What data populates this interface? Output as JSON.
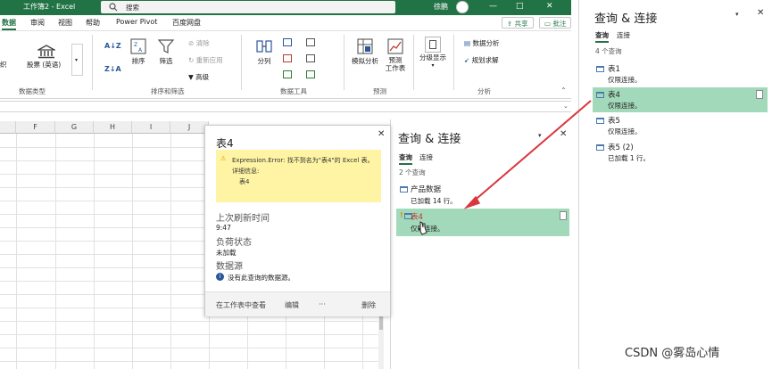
{
  "title_bar": {
    "title": "工作簿2 - Excel",
    "search_placeholder": "搜索",
    "user": "徐鹏",
    "win_min": "—",
    "win_max": "□",
    "win_close": "✕"
  },
  "menu": {
    "items": [
      "数据",
      "审阅",
      "视图",
      "帮助",
      "Power Pivot",
      "百度网盘"
    ],
    "share": "共享",
    "comment": "批注"
  },
  "ribbon": {
    "datatype": {
      "frag": "织",
      "stocks": "股票 (英语)",
      "group": "数据类型"
    },
    "sort_filter": {
      "sort": "排序",
      "filter": "筛选",
      "clear": "清除",
      "reapply": "重新应用",
      "advanced": "高级",
      "group": "排序和筛选"
    },
    "data_tools": {
      "split": "分列",
      "group": "数据工具"
    },
    "forecast": {
      "whatif": "模拟分析",
      "forecast_sheet": "预测\n工作表",
      "group": "预测"
    },
    "outline": {
      "label": "分级显示"
    },
    "analysis": {
      "data_analysis": "数据分析",
      "solver": "规划求解",
      "group": "分析"
    }
  },
  "grid": {
    "columns": [
      "F",
      "G",
      "H",
      "I",
      "J"
    ]
  },
  "pane_inner": {
    "title": "查询 & 连接",
    "tab_queries": "查询",
    "tab_connections": "连接",
    "count": "2 个查询",
    "queries": [
      {
        "name": "产品数据",
        "status": "已加载 14 行。"
      },
      {
        "name": "表4",
        "status": "仅限连接。"
      }
    ]
  },
  "popup": {
    "title": "表4",
    "error_line1": "Expression.Error: 找不到名为\"表4\"的 Excel 表。",
    "error_line2": "详细信息:",
    "error_line3": "表4",
    "refresh_label": "上次刷新时间",
    "refresh_value": "9:47",
    "load_label": "负荷状态",
    "load_value": "未加载",
    "source_label": "数据源",
    "source_value": "没有此查询的数据源。",
    "footer": {
      "view": "在工作表中查看",
      "edit": "编辑",
      "more": "···",
      "delete": "删除"
    }
  },
  "pane_outer": {
    "title": "查询 & 连接",
    "tab_queries": "查询",
    "tab_connections": "连接",
    "count": "4 个查询",
    "queries": [
      {
        "name": "表1",
        "status": "仅限连接。"
      },
      {
        "name": "表4",
        "status": "仅限连接。"
      },
      {
        "name": "表5",
        "status": "仅限连接。"
      },
      {
        "name": "表5 (2)",
        "status": "已加载 1 行。"
      }
    ]
  },
  "watermark": "CSDN @雾岛心情",
  "colors": {
    "excel_green": "#217346",
    "selected_bg": "#a3d9bb",
    "error_bg": "#fff4a3",
    "arrow_red": "#d9363e"
  }
}
